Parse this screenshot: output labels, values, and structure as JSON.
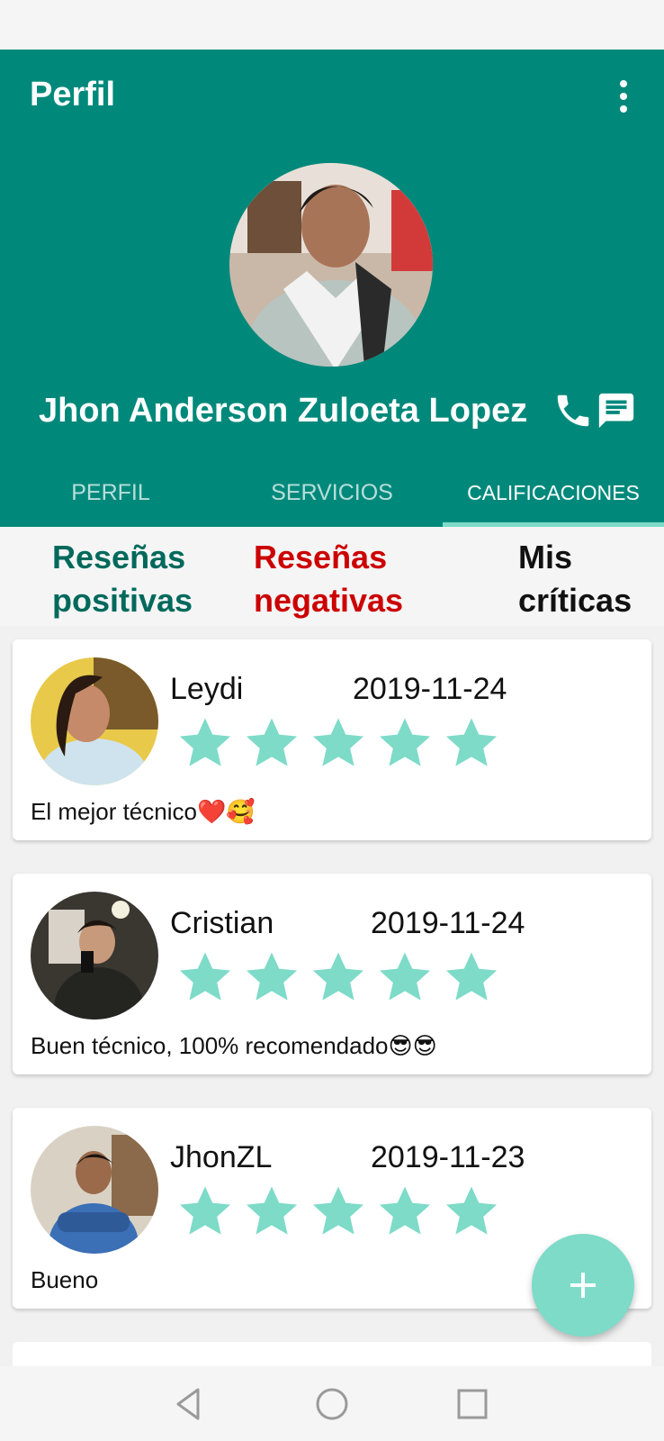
{
  "app_bar": {
    "title": "Perfil"
  },
  "profile": {
    "name": "Jhon Anderson Zuloeta Lopez"
  },
  "tabs": [
    {
      "label": "PERFIL",
      "active": false
    },
    {
      "label": "SERVICIOS",
      "active": false
    },
    {
      "label": "CALIFICACIONES",
      "active": true
    }
  ],
  "review_filters": {
    "positive": "Reseñas positivas",
    "negative": "Reseñas negativas",
    "mine": "Mis críticas"
  },
  "reviews": [
    {
      "user": "Leydi",
      "date": "2019-11-24",
      "rating": 5,
      "comment": "El mejor técnico❤️🥰"
    },
    {
      "user": "Cristian",
      "date": "2019-11-24",
      "rating": 5,
      "comment": "Buen técnico, 100% recomendado😎😎"
    },
    {
      "user": "JhonZL",
      "date": "2019-11-23",
      "rating": 5,
      "comment": "Bueno"
    }
  ],
  "colors": {
    "primary": "#00897b",
    "accent": "#7ddbc8",
    "positive": "#00695c",
    "negative": "#cc0000"
  },
  "icons": {
    "phone": "phone-icon",
    "chat": "chat-icon",
    "menu": "more-vert-icon",
    "fab": "plus-icon",
    "star": "star-icon"
  }
}
